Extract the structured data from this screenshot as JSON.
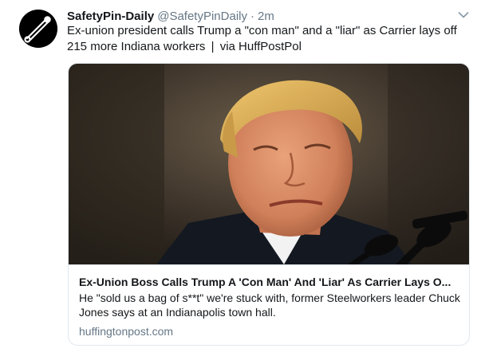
{
  "tweet": {
    "display_name": "SafetyPin-Daily",
    "handle": "@SafetyPinDaily",
    "separator": "·",
    "time": "2m",
    "text_main": "Ex-union president calls Trump a \"con man\" and a \"liar\" as Carrier lays off 215 more Indiana workers",
    "text_sep": "|",
    "text_via": "via HuffPostPol",
    "avatar_icon": "safety-pin-icon",
    "caret_icon": "chevron-down-icon"
  },
  "card": {
    "image_alt": "man-portrait-photo",
    "title": "Ex-Union Boss Calls Trump A 'Con Man' And 'Liar' As Carrier Lays O...",
    "description": "He \"sold us a bag of s**t\" we're stuck with, former Steelworkers leader Chuck Jones says at an Indianapolis town hall.",
    "domain": "huffingtonpost.com"
  },
  "colors": {
    "text": "#14171a",
    "secondary": "#657786",
    "border": "#e1e8ed"
  }
}
